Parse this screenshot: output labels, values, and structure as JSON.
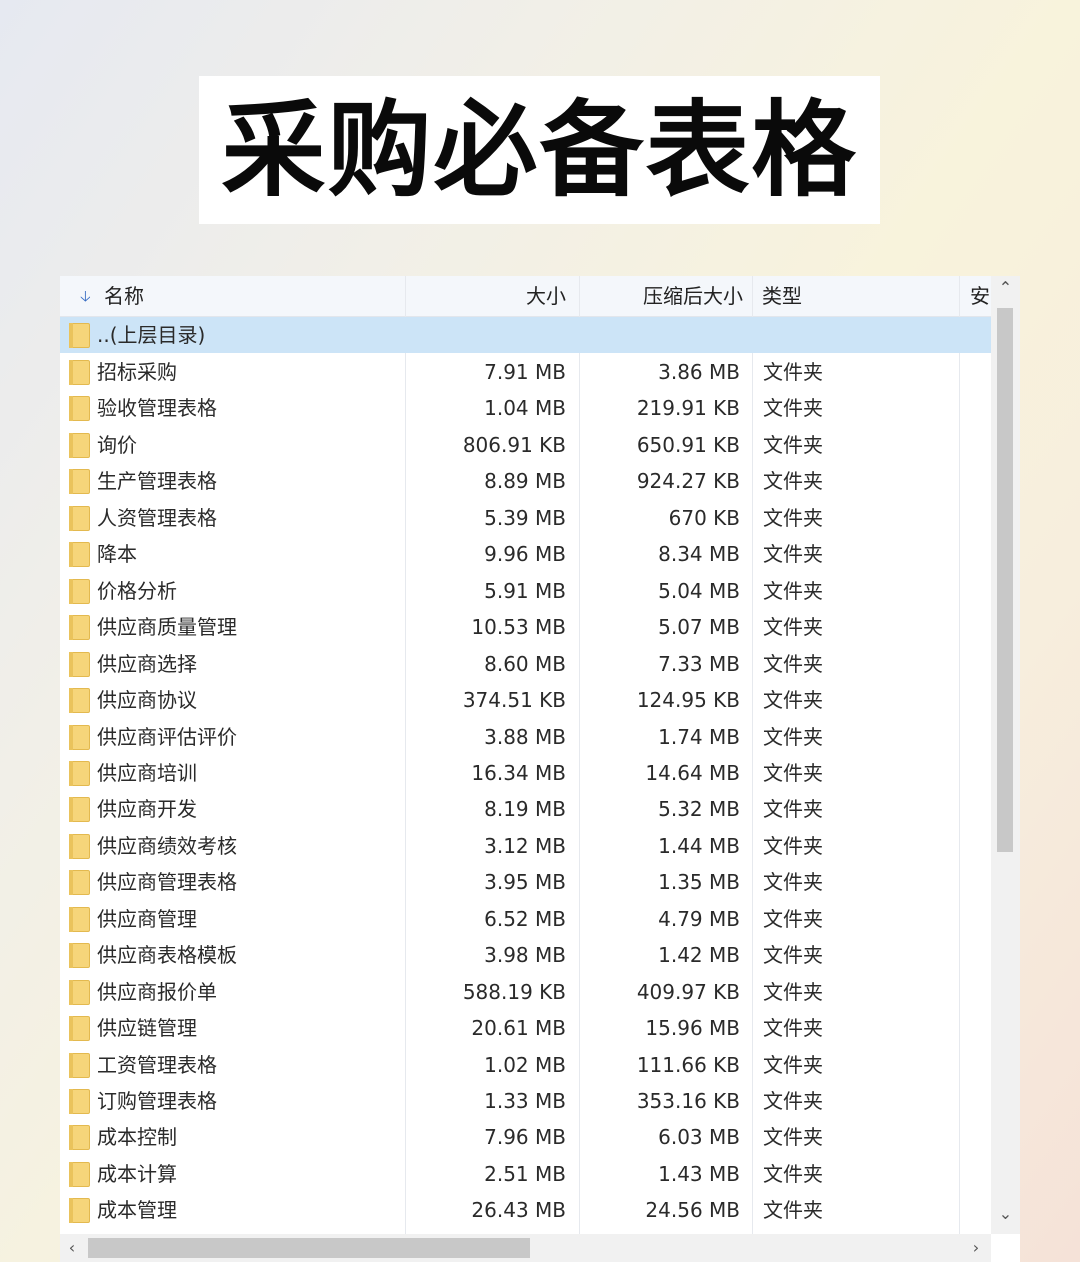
{
  "title": "采购必备表格",
  "columns": {
    "name": "名称",
    "size": "大小",
    "compressed": "压缩后大小",
    "type": "类型",
    "partial": "安"
  },
  "icons": {
    "sort": "sort-down-icon",
    "folder": "folder-icon",
    "scroll_up": "chevron-up-icon",
    "scroll_down": "chevron-down-icon",
    "scroll_left": "chevron-left-icon",
    "scroll_right": "chevron-right-icon"
  },
  "parent_row": {
    "name": "..(上层目录)"
  },
  "rows": [
    {
      "name": "招标采购",
      "size": "7.91 MB",
      "compressed": "3.86 MB",
      "type": "文件夹"
    },
    {
      "name": "验收管理表格",
      "size": "1.04 MB",
      "compressed": "219.91 KB",
      "type": "文件夹"
    },
    {
      "name": "询价",
      "size": "806.91 KB",
      "compressed": "650.91 KB",
      "type": "文件夹"
    },
    {
      "name": "生产管理表格",
      "size": "8.89 MB",
      "compressed": "924.27 KB",
      "type": "文件夹"
    },
    {
      "name": "人资管理表格",
      "size": "5.39 MB",
      "compressed": "670 KB",
      "type": "文件夹"
    },
    {
      "name": "降本",
      "size": "9.96 MB",
      "compressed": "8.34 MB",
      "type": "文件夹"
    },
    {
      "name": "价格分析",
      "size": "5.91 MB",
      "compressed": "5.04 MB",
      "type": "文件夹"
    },
    {
      "name": "供应商质量管理",
      "size": "10.53 MB",
      "compressed": "5.07 MB",
      "type": "文件夹"
    },
    {
      "name": "供应商选择",
      "size": "8.60 MB",
      "compressed": "7.33 MB",
      "type": "文件夹"
    },
    {
      "name": "供应商协议",
      "size": "374.51 KB",
      "compressed": "124.95 KB",
      "type": "文件夹"
    },
    {
      "name": "供应商评估评价",
      "size": "3.88 MB",
      "compressed": "1.74 MB",
      "type": "文件夹"
    },
    {
      "name": "供应商培训",
      "size": "16.34 MB",
      "compressed": "14.64 MB",
      "type": "文件夹"
    },
    {
      "name": "供应商开发",
      "size": "8.19 MB",
      "compressed": "5.32 MB",
      "type": "文件夹"
    },
    {
      "name": "供应商绩效考核",
      "size": "3.12 MB",
      "compressed": "1.44 MB",
      "type": "文件夹"
    },
    {
      "name": "供应商管理表格",
      "size": "3.95 MB",
      "compressed": "1.35 MB",
      "type": "文件夹"
    },
    {
      "name": "供应商管理",
      "size": "6.52 MB",
      "compressed": "4.79 MB",
      "type": "文件夹"
    },
    {
      "name": "供应商表格模板",
      "size": "3.98 MB",
      "compressed": "1.42 MB",
      "type": "文件夹"
    },
    {
      "name": "供应商报价单",
      "size": "588.19 KB",
      "compressed": "409.97 KB",
      "type": "文件夹"
    },
    {
      "name": "供应链管理",
      "size": "20.61 MB",
      "compressed": "15.96 MB",
      "type": "文件夹"
    },
    {
      "name": "工资管理表格",
      "size": "1.02 MB",
      "compressed": "111.66 KB",
      "type": "文件夹"
    },
    {
      "name": "订购管理表格",
      "size": "1.33 MB",
      "compressed": "353.16 KB",
      "type": "文件夹"
    },
    {
      "name": "成本控制",
      "size": "7.96 MB",
      "compressed": "6.03 MB",
      "type": "文件夹"
    },
    {
      "name": "成本计算",
      "size": "2.51 MB",
      "compressed": "1.43 MB",
      "type": "文件夹"
    },
    {
      "name": "成本管理",
      "size": "26.43 MB",
      "compressed": "24.56 MB",
      "type": "文件夹"
    }
  ]
}
